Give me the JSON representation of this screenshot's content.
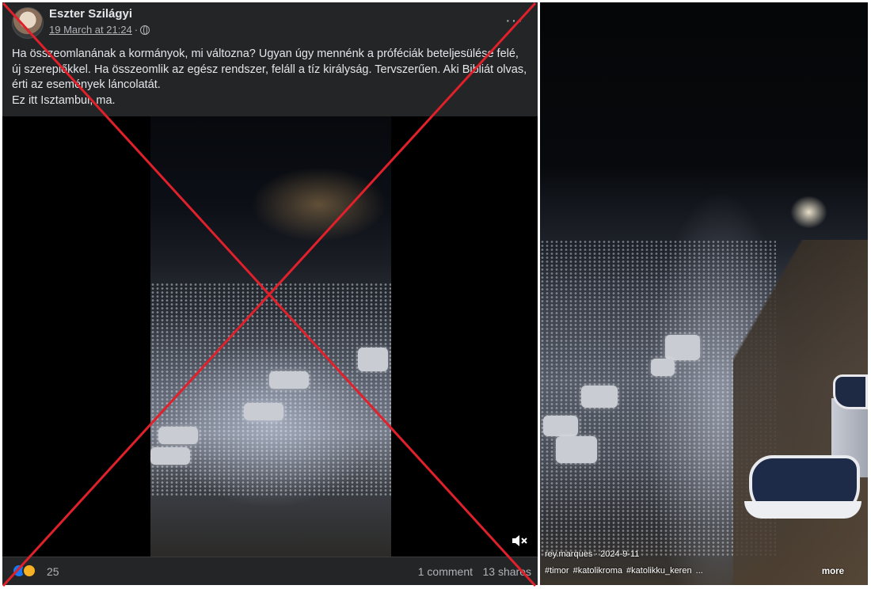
{
  "post": {
    "author": "Eszter Szilágyi",
    "date": "19 March at 21:24",
    "separator": "·",
    "text_lines": [
      "Ha összeomlanának a kormányok, mi változna? Ugyan úgy mennénk a próféciák beteljesülése felé,",
      "új szereplőkkel. Ha összeomlik az egész rendszer, feláll a tíz királyság. Tervszerűen. Aki Bibliát olvas,",
      "érti az események láncolatát.",
      "Ez itt Isztambul, ma."
    ],
    "more_menu": "···",
    "reaction_count": "25",
    "comments": "1 comment",
    "shares": "13 shares"
  },
  "icons": {
    "avatar": "profile-photo",
    "privacy": "globe-icon",
    "menu": "ellipsis-icon",
    "mute": "speaker-muted-icon",
    "reactions": [
      "like-icon",
      "wow-icon"
    ]
  },
  "overlay": {
    "mark": "red-cross",
    "color": "#e0202a"
  },
  "original_video": {
    "handle": "rey.marques · 2024-9-11",
    "hashtags": "#timor  #katolikroma  #katolikku_keren  ...",
    "more": "more"
  },
  "colors": {
    "fb_dark": "#242526",
    "fb_text": "#e4e6eb",
    "fb_muted": "#b0b3b8",
    "like_blue": "#1877f2"
  }
}
